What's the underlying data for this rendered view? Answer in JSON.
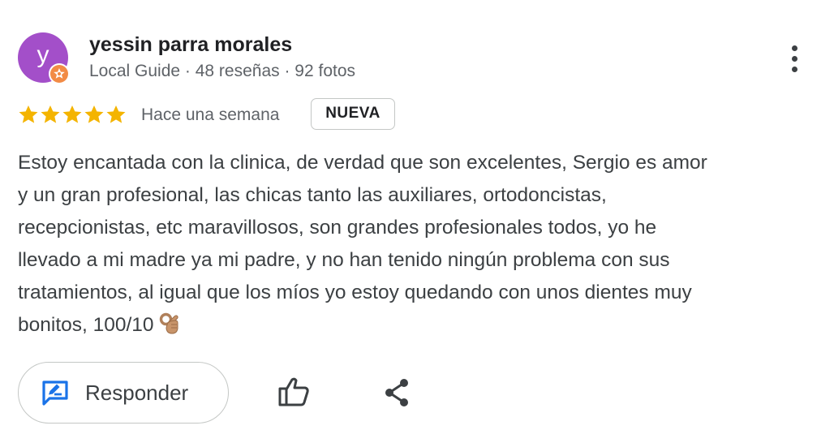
{
  "author": {
    "initial": "y",
    "name": "yessin parra morales",
    "meta": "Local Guide · 48 reseñas · 92 fotos",
    "avatar_color": "#a34fc9",
    "badge_color": "#f28b45",
    "badge_icon": "local-guide-star-icon"
  },
  "review": {
    "rating": 5,
    "max_rating": 5,
    "star_color": "#f4b400",
    "date": "Hace una semana",
    "badge": "NUEVA",
    "text_lines": [
      "Estoy encantada con la clinica, de verdad que son excelentes, Sergio es amor",
      "y un gran profesional, las chicas tanto las auxiliares, ortodoncistas,",
      "recepcionistas, etc maravillosos, son grandes profesionales todos, yo he",
      "llevado a mi madre ya mi padre, y no han tenido ningún problema con sus",
      "tratamientos, al igual que los míos yo estoy quedando con unos dientes muy",
      "bonitos, 100/10"
    ],
    "trailing_emoji": "ok-hand-emoji"
  },
  "actions": {
    "reply_label": "Responder",
    "reply_icon": "reply-icon",
    "reply_icon_color": "#1a73e8",
    "like_icon": "thumb-up-icon",
    "share_icon": "share-icon",
    "more_icon": "more-vert-icon"
  }
}
